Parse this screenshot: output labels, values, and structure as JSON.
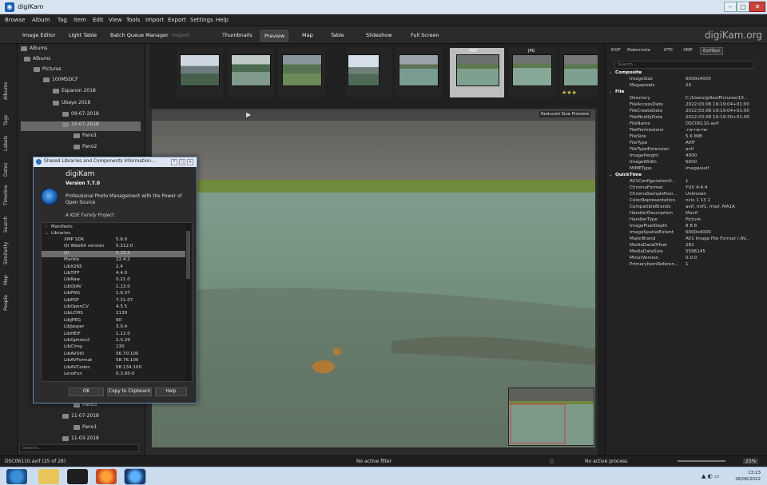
{
  "window": {
    "title": "digiKam"
  },
  "menu": [
    "Browse",
    "Album",
    "Tag",
    "Item",
    "Edit",
    "View",
    "Tools",
    "Import",
    "Export",
    "Settings",
    "Help"
  ],
  "toolbar": {
    "image_editor": "Image Editor",
    "light_table": "Light Table",
    "batch_queue": "Batch Queue Manager",
    "import": "Import",
    "thumbnails": "Thumbnails",
    "preview": "Preview",
    "map": "Map",
    "table": "Table",
    "slideshow": "Slideshow",
    "full_screen": "Full Screen",
    "brand": "digiKam.org"
  },
  "left_tabs": [
    "Albums",
    "Tags",
    "Labels",
    "Dates",
    "Timeline",
    "Search",
    "Similarity",
    "Map",
    "People"
  ],
  "albums": {
    "header": "Albums",
    "tree": [
      {
        "label": "Albums"
      },
      {
        "label": "Pictures"
      },
      {
        "label": "100MSDCF"
      },
      {
        "label": "Espanon 2018"
      },
      {
        "label": "Ubaye 2018"
      },
      {
        "label": "09-07-2018"
      },
      {
        "label": "10-07-2018"
      },
      {
        "label": "Pano1"
      },
      {
        "label": "Pano2"
      },
      {
        "label": "Pano3"
      },
      {
        "label": "11-07-2018"
      },
      {
        "label": "Pano1"
      },
      {
        "label": "11-03-2018"
      }
    ],
    "search_placeholder": "Search..."
  },
  "thumbs": [
    {
      "badge": ""
    },
    {
      "badge": ""
    },
    {
      "badge": ""
    },
    {
      "badge": ""
    },
    {
      "badge": ""
    },
    {
      "badge": "AVIF"
    },
    {
      "badge": "JPG"
    },
    {
      "badge": ""
    }
  ],
  "thumb_stars": "★★★",
  "viewer": {
    "preview_label": "Reduced Size Preview"
  },
  "right_panel": {
    "tabs": [
      "EXIF",
      "Makernote",
      "IPTC",
      "XMP",
      "ExifTool"
    ],
    "search_placeholder": "Search...",
    "groups": [
      {
        "name": "Composite",
        "rows": [
          [
            "ImageSize",
            "6000x4000"
          ],
          [
            "Megapixels",
            "24"
          ]
        ]
      },
      {
        "name": "File",
        "rows": [
          [
            "Directory",
            "C:/Users/gilles/Pictures/10..."
          ],
          [
            "FileAccessDate",
            "2022:03:08 19:19:04+01:00"
          ],
          [
            "FileCreateDate",
            "2022:03:08 19:19:04+01:00"
          ],
          [
            "FileModifyDate",
            "2022:03:08 19:19:30+01:00"
          ],
          [
            "FileName",
            "DSC06110.avif"
          ],
          [
            "FilePermissions",
            "-rw-rw-rw-"
          ],
          [
            "FileSize",
            "5.6 MiB"
          ],
          [
            "FileType",
            "AVIF"
          ],
          [
            "FileTypeExtension",
            "avif"
          ],
          [
            "ImageHeight",
            "4000"
          ],
          [
            "ImageWidth",
            "6000"
          ],
          [
            "MIMEType",
            "image/avif"
          ]
        ]
      },
      {
        "name": "QuickTime",
        "rows": [
          [
            "AV1ConfigurationV...",
            "1"
          ],
          [
            "ChromaFormat",
            "YUV 4:4:4"
          ],
          [
            "ChromaSamplePosi...",
            "Unknown"
          ],
          [
            "ColorRepresentation",
            "nclx 1 13 1"
          ],
          [
            "CompatibleBrands",
            "avif, mif1, miaf, MA1A"
          ],
          [
            "HandlerDescription",
            "Mavif"
          ],
          [
            "HandlerType",
            "Picture"
          ],
          [
            "ImagePixelDepth",
            "8 8 8"
          ],
          [
            "ImageSpatialExtent",
            "6000x4000"
          ],
          [
            "MajorBrand",
            "AV1 Image File Format (.AV..."
          ],
          [
            "MediaDataOffset",
            "282"
          ],
          [
            "MediaDataSize",
            "5596145"
          ],
          [
            "MinorVersion",
            "0.0.0"
          ],
          [
            "PrimaryItemReferen...",
            "1"
          ]
        ]
      }
    ]
  },
  "dialog": {
    "title": "Shared Libraries and Components Information...",
    "app": "digiKam",
    "version": "Version 7.7.0",
    "description": "Professional Photo Management with the Power of Open Source",
    "kde": "A KDE Family Project",
    "groups": [
      {
        "name": "Manifests"
      },
      {
        "name": "Libraries"
      }
    ],
    "libs": [
      [
        "XMP SDK",
        "5.6.0"
      ],
      [
        "Qt WebKit version",
        "5.212.0"
      ],
      [
        "Qt",
        "5.15.5"
      ],
      [
        "Marble",
        "22.4.2"
      ],
      [
        "LibX265",
        "2.4"
      ],
      [
        "LibTIFF",
        "4.4.0"
      ],
      [
        "LibRaw",
        "0.21.0"
      ],
      [
        "LibQtAV",
        "1.13.0"
      ],
      [
        "LibPNG",
        "1.6.37"
      ],
      [
        "LibPGF",
        "7.21.07"
      ],
      [
        "LibOpenCV",
        "4.5.5"
      ],
      [
        "LibLCMS",
        "2130"
      ],
      [
        "LibJPEG",
        "90"
      ],
      [
        "LibJasper",
        "3.0.4"
      ],
      [
        "LibHEIF",
        "1.12.0"
      ],
      [
        "LibGphoto2",
        "2.5.29"
      ],
      [
        "LibCImg",
        "130"
      ],
      [
        "LibAVUtil",
        "56.70.100"
      ],
      [
        "LibAVFormat",
        "58.76.100"
      ],
      [
        "LibAVCodec",
        "58.134.100"
      ],
      [
        "LensFun",
        "0.3.95-0"
      ]
    ],
    "ok": "OK",
    "copy": "Copy to Clipboard",
    "help": "Help"
  },
  "status": {
    "file": "DSC06110.avif (25 of 28)",
    "filter": "No active filter",
    "process": "No active process",
    "zoom": "25%"
  },
  "clock": {
    "time": "13:23",
    "date": "26/06/2022"
  }
}
